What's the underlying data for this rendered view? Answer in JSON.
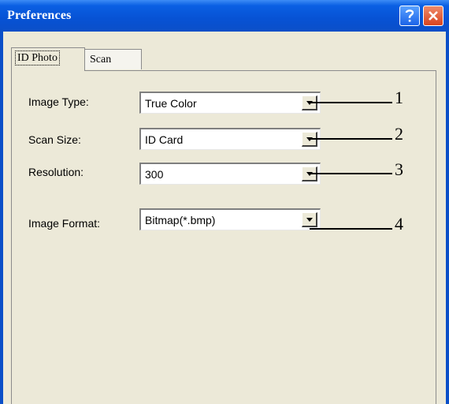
{
  "window": {
    "title": "Preferences",
    "help_icon": "question-mark-icon",
    "close_icon": "close-x-icon",
    "colors": {
      "titlebar": "#0a5fe3",
      "face": "#ece9d8",
      "close": "#d8431d"
    }
  },
  "tabs": [
    {
      "label": "ID Photo",
      "active": true
    },
    {
      "label": "Scan",
      "active": false
    }
  ],
  "fields": [
    {
      "label": "Image Type:",
      "value": "True Color",
      "callout": "1"
    },
    {
      "label": "Scan Size:",
      "value": "ID Card",
      "callout": "2"
    },
    {
      "label": "Resolution:",
      "value": "300",
      "callout": "3"
    },
    {
      "label": "Image Format:",
      "value": "Bitmap(*.bmp)",
      "callout": "4"
    }
  ]
}
